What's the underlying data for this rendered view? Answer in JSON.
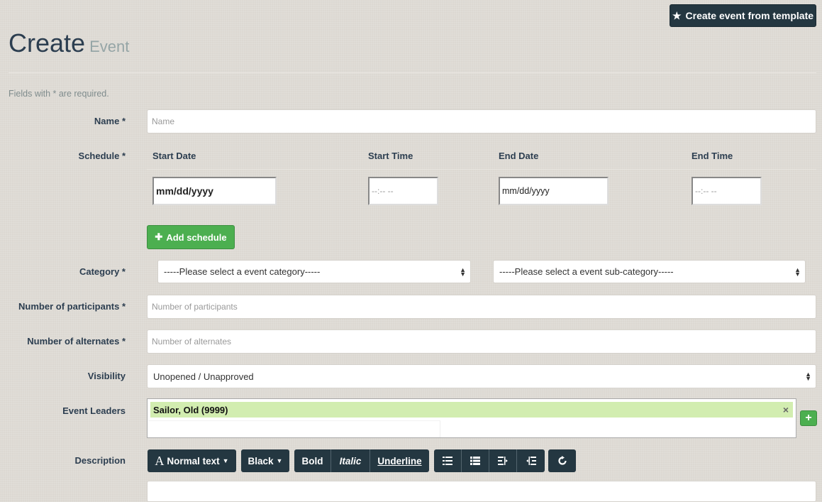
{
  "header": {
    "template_button": "Create event from template",
    "title": "Create",
    "subtitle": "Event",
    "required_note": "Fields with * are required."
  },
  "form": {
    "name": {
      "label": "Name *",
      "placeholder": "Name"
    },
    "schedule": {
      "label": "Schedule *",
      "columns": [
        "Start Date",
        "Start Time",
        "End Date",
        "End Time"
      ],
      "start_date": "mm/dd/yyyy",
      "start_time": "--:-- --",
      "end_date": "mm/dd/yyyy",
      "end_time": "--:-- --",
      "add_button": "Add schedule"
    },
    "category": {
      "label": "Category *",
      "category_value": "-----Please select a event category-----",
      "subcategory_value": "-----Please select a event sub-category-----"
    },
    "participants": {
      "label": "Number of participants *",
      "placeholder": "Number of participants"
    },
    "alternates": {
      "label": "Number of alternates *",
      "placeholder": "Number of alternates"
    },
    "visibility": {
      "label": "Visibility",
      "value": "Unopened / Unapproved"
    },
    "leaders": {
      "label": "Event Leaders",
      "selected": "Sailor, Old (9999)",
      "remove": "×",
      "add": "+"
    },
    "description": {
      "label": "Description",
      "toolbar": {
        "font": "Normal text",
        "color": "Black",
        "bold": "Bold",
        "italic": "Italic",
        "underline": "Underline"
      }
    }
  },
  "icons": {
    "star": "star-icon",
    "plus": "plus-icon",
    "font": "font-icon",
    "caret": "caret-down-icon",
    "unordered_list": "list-icon",
    "ordered_list": "numbered-list-icon",
    "outdent": "outdent-icon",
    "indent": "indent-icon",
    "undo": "undo-icon"
  },
  "colors": {
    "dark_button": "#243741",
    "green_button": "#4caf50",
    "tag_bg": "#d2edb0"
  }
}
